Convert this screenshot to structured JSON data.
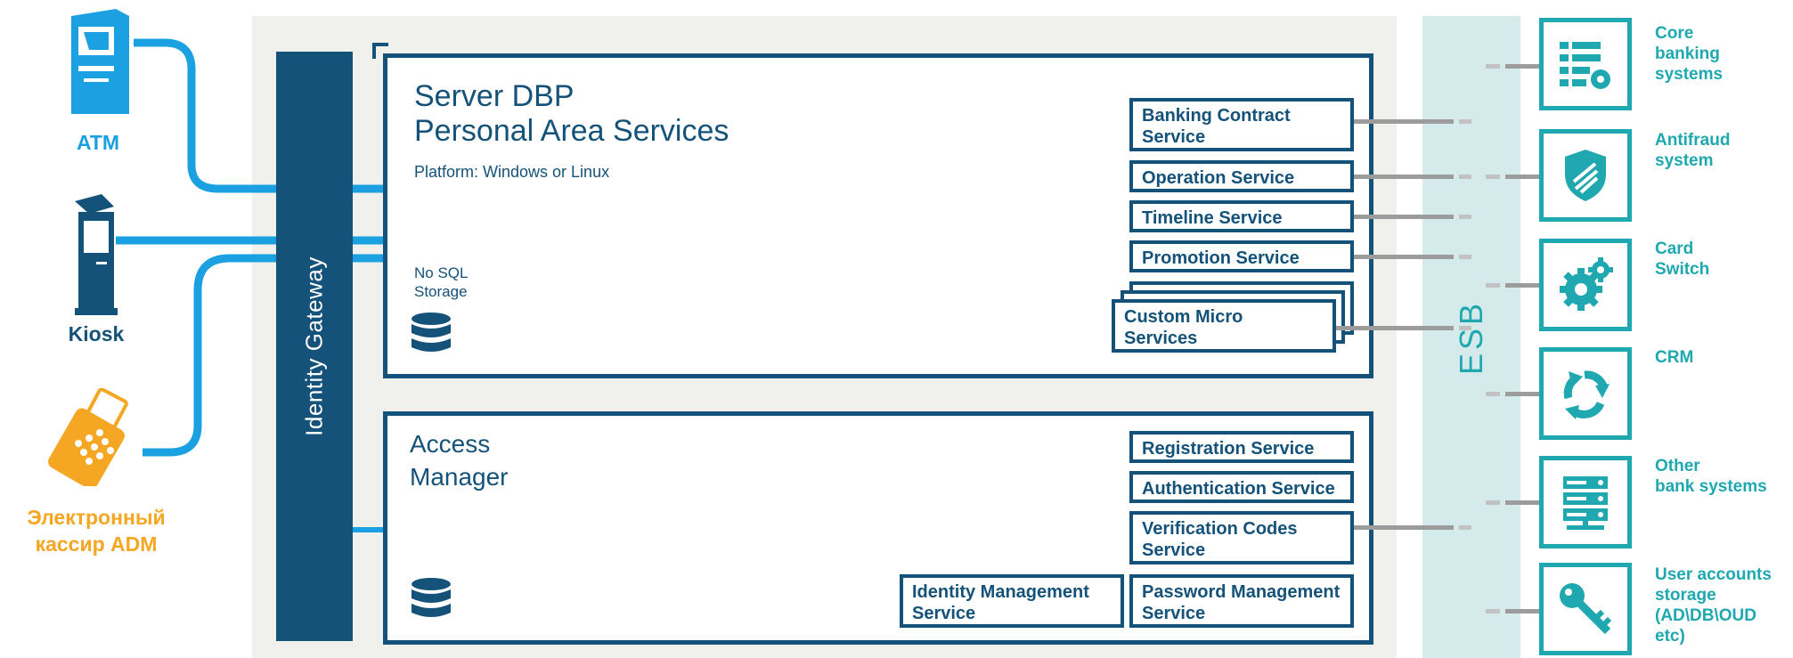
{
  "devices": {
    "atm": "ATM",
    "kiosk": "Kiosk",
    "cashier_line1": "Электронный",
    "cashier_line2": "кассир ADM"
  },
  "gateway": {
    "label": "Identity Gateway"
  },
  "server": {
    "title_line1": "Server DBP",
    "title_line2": "Personal Area Services",
    "platform": "Platform: Windows or Linux",
    "storage_line1": "No SQL",
    "storage_line2": "Storage",
    "services": [
      {
        "line1": "Banking Contract",
        "line2": "Service"
      },
      {
        "line1": "Operation Service"
      },
      {
        "line1": "Timeline Service"
      },
      {
        "line1": "Promotion Service"
      },
      {
        "line1": "Custom Micro",
        "line2": "Services"
      }
    ]
  },
  "access": {
    "title_line1": "Access",
    "title_line2": "Manager",
    "services": [
      {
        "line1": "Registration Service"
      },
      {
        "line1": "Authentication Service"
      },
      {
        "line1": "Verification Codes",
        "line2": "Service"
      },
      {
        "line1": "Password Management",
        "line2": "Service"
      },
      {
        "line1": "Identity Management",
        "line2": "Service"
      }
    ]
  },
  "esb": {
    "label": "ESB"
  },
  "external": [
    {
      "lines": [
        "Core",
        "banking",
        "systems"
      ],
      "icon": "core-banking-icon"
    },
    {
      "lines": [
        "Antifraud",
        "system"
      ],
      "icon": "shield-icon"
    },
    {
      "lines": [
        "Card",
        "Switch"
      ],
      "icon": "gears-icon"
    },
    {
      "lines": [
        "CRM"
      ],
      "icon": "recycle-arrows-icon"
    },
    {
      "lines": [
        "Other",
        "bank systems"
      ],
      "icon": "server-rack-icon"
    },
    {
      "lines": [
        "User accounts",
        "storage",
        "(AD\\DB\\OUD",
        "etc)"
      ],
      "icon": "key-icon"
    }
  ],
  "colors": {
    "navy": "#145279",
    "teal": "#1fa8b0",
    "device_blue": "#1ba1e2",
    "cashier_orange": "#f5a623",
    "esb_band": "#d5eaea",
    "panel": "#f0f1ec"
  }
}
